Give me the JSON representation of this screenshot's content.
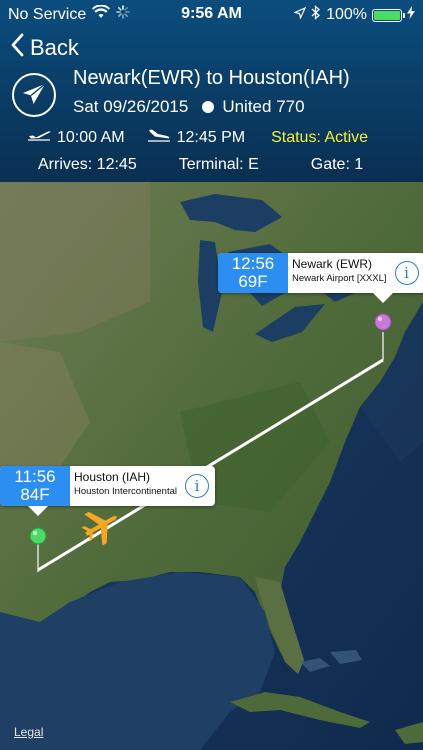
{
  "statusbar": {
    "carrier": "No Service",
    "time": "9:56 AM",
    "battery_percent": "100%",
    "battery_level": 1.0
  },
  "nav": {
    "back_label": "Back"
  },
  "flight": {
    "route": "Newark(EWR) to Houston(IAH)",
    "date": "Sat 09/26/2015",
    "airline_flight": "United 770",
    "depart_time": "10:00 AM",
    "arrive_time": "12:45 PM",
    "status": "Status: Active",
    "arrives": "Arrives: 12:45",
    "terminal": "Terminal: E",
    "gate": "Gate: 1"
  },
  "map": {
    "origin": {
      "time": "12:56",
      "temp": "69F",
      "name": "Newark (EWR)",
      "airport": "Newark Airport [XXXL]",
      "pin_color": "#c77bd6"
    },
    "destination": {
      "time": "11:56",
      "temp": "84F",
      "name": "Houston (IAH)",
      "airport": "Houston Intercontinental",
      "pin_color": "#4cd964"
    },
    "legal_label": "Legal"
  },
  "colors": {
    "accent": "#2b8ef0",
    "status": "#f5ef3b",
    "plane": "#f5a623"
  }
}
